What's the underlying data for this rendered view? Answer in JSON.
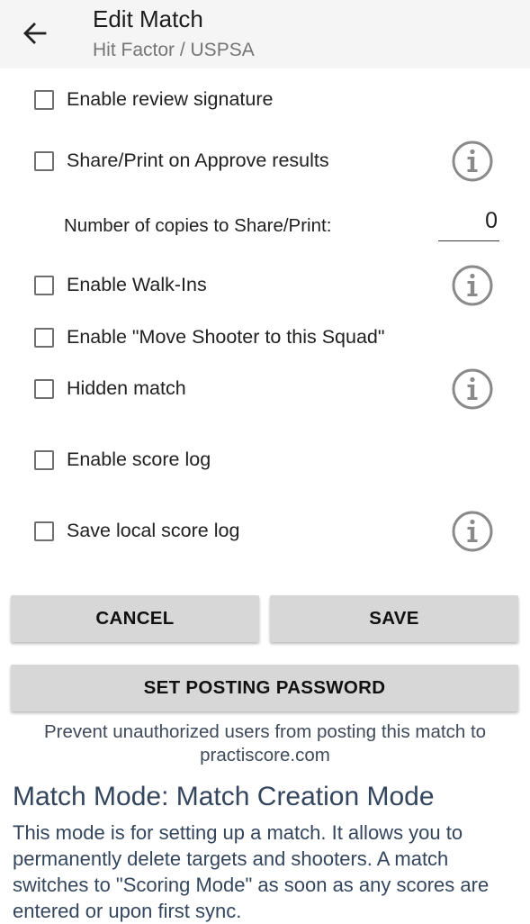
{
  "header": {
    "title": "Edit Match",
    "subtitle": "Hit Factor / USPSA",
    "back_icon": "arrow-left-icon"
  },
  "options": [
    {
      "label": "Enable review signature",
      "checked": false,
      "info": false
    },
    {
      "label": "Share/Print on Approve results",
      "checked": false,
      "info": true
    },
    {
      "label": "Enable Walk-Ins",
      "checked": false,
      "info": true
    },
    {
      "label": "Enable \"Move Shooter to this Squad\"",
      "checked": false,
      "info": false
    },
    {
      "label": "Hidden match",
      "checked": false,
      "info": true
    },
    {
      "label": "Enable score log",
      "checked": false,
      "info": false
    },
    {
      "label": "Save local score log",
      "checked": false,
      "info": true
    }
  ],
  "copies": {
    "label": "Number of copies to Share/Print:",
    "value": "0"
  },
  "buttons": {
    "cancel": "CANCEL",
    "save": "SAVE",
    "set_posting_password": "SET POSTING PASSWORD"
  },
  "posting_note": "Prevent unauthorized users from posting this match to practiscore.com",
  "mode": {
    "title": "Match Mode: Match Creation Mode",
    "description": "This mode is for setting up a match. It allows you to permanently delete targets and shooters. A match switches to \"Scoring Mode\" as soon as any scores are entered or upon first sync."
  },
  "colors": {
    "appbar_bg": "#f5f5f5",
    "button_bg": "#d7d7d7",
    "mode_text": "#34465e"
  }
}
